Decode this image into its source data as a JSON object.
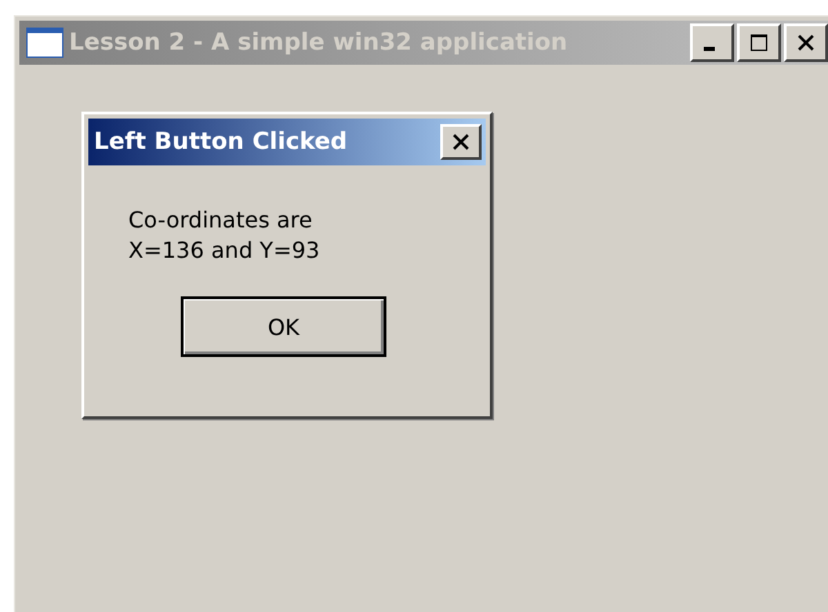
{
  "window": {
    "title": "Lesson 2 - A simple win32 application",
    "active": false
  },
  "dialog": {
    "title": "Left Button Clicked",
    "active": true,
    "message": [
      "Co-ordinates are",
      "X=136 and Y=93"
    ],
    "buttons": [
      "OK"
    ]
  }
}
